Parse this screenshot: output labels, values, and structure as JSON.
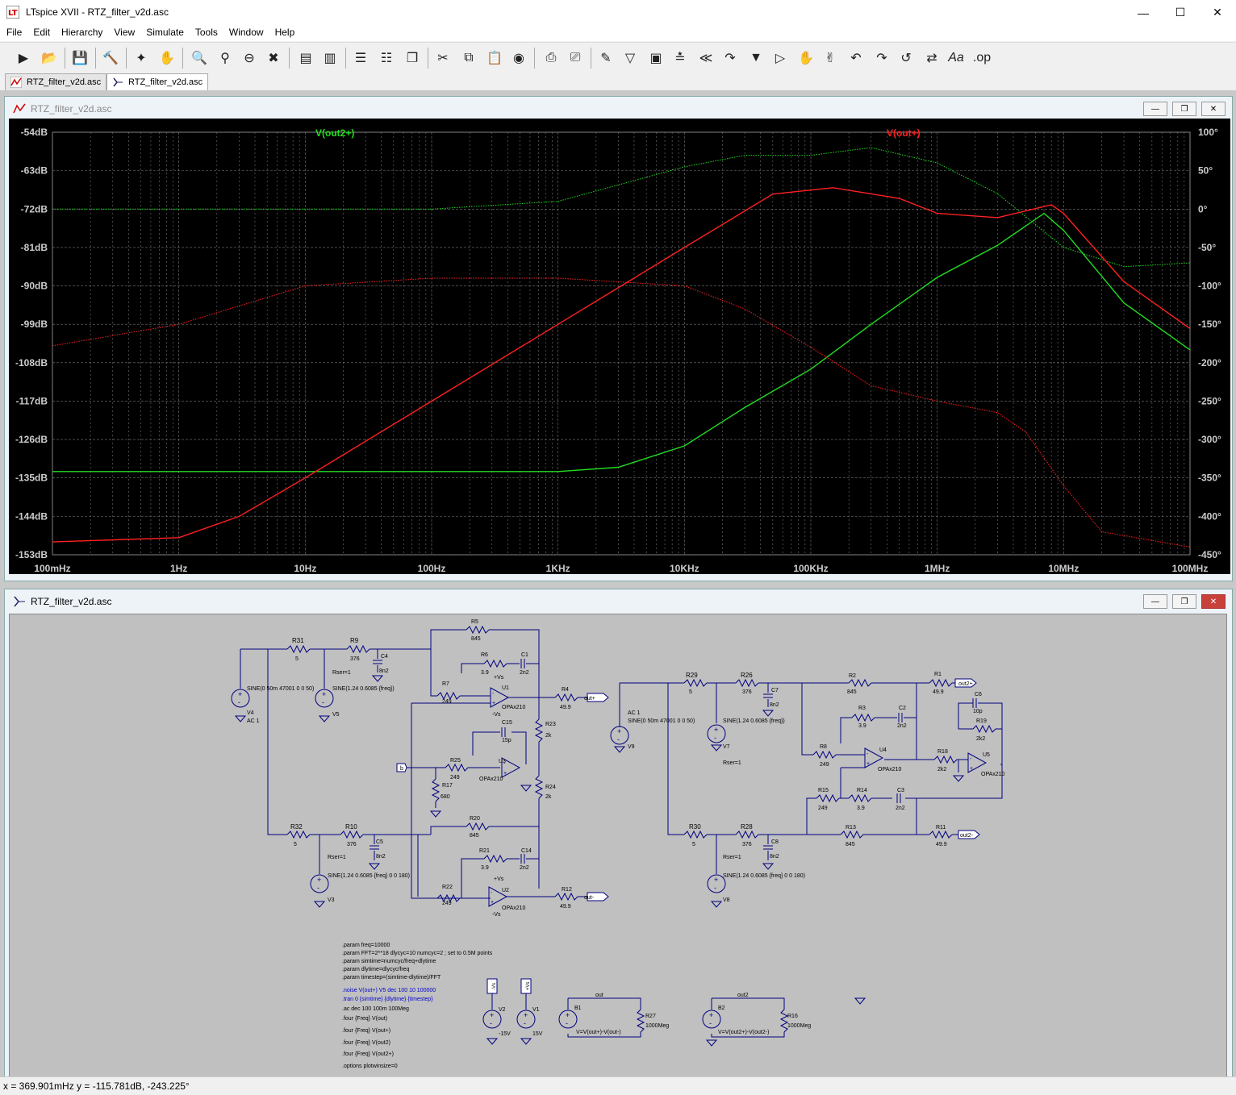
{
  "window": {
    "title": "LTspice XVII - RTZ_filter_v2d.asc"
  },
  "menu": [
    "File",
    "Edit",
    "Hierarchy",
    "View",
    "Simulate",
    "Tools",
    "Window",
    "Help"
  ],
  "tabs": [
    {
      "label": "RTZ_filter_v2d.asc",
      "kind": "waveform"
    },
    {
      "label": "RTZ_filter_v2d.asc",
      "kind": "schematic"
    }
  ],
  "plot_window": {
    "title": "RTZ_filter_v2d.asc"
  },
  "schematic_window": {
    "title": "RTZ_filter_v2d.asc"
  },
  "chart_data": {
    "type": "line",
    "x_scale": "log",
    "x_ticks": [
      "100mHz",
      "1Hz",
      "10Hz",
      "100Hz",
      "1KHz",
      "10KHz",
      "100KHz",
      "1MHz",
      "10MHz",
      "100MHz"
    ],
    "y_left_ticks": [
      "-54dB",
      "-63dB",
      "-72dB",
      "-81dB",
      "-90dB",
      "-99dB",
      "-108dB",
      "-117dB",
      "-126dB",
      "-135dB",
      "-144dB",
      "-153dB"
    ],
    "y_right_ticks": [
      "100°",
      "50°",
      "0°",
      "-50°",
      "-100°",
      "-150°",
      "-200°",
      "-250°",
      "-300°",
      "-350°",
      "-400°",
      "-450°"
    ],
    "ylim_db": [
      -153,
      -54
    ],
    "ylim_deg": [
      -450,
      100
    ],
    "grid": true,
    "series": [
      {
        "name": "V(out2+)",
        "color": "#22dd22",
        "kind": "magnitude",
        "x": [
          0.1,
          1,
          10,
          100,
          1000,
          3000,
          10000,
          30000,
          100000,
          300000,
          1000000,
          3000000,
          7000000,
          10000000,
          30000000,
          100000000
        ],
        "y": [
          -133.5,
          -133.5,
          -133.5,
          -133.5,
          -133.5,
          -132.5,
          -127.5,
          -118.5,
          -109.5,
          -99,
          -88,
          -80.5,
          -73,
          -77,
          -94,
          -105
        ]
      },
      {
        "name": "V(out2+)",
        "color": "#22dd22",
        "kind": "phase",
        "x": [
          0.1,
          1,
          10,
          100,
          1000,
          10000,
          30000,
          100000,
          300000,
          1000000,
          3000000,
          10000000,
          30000000,
          100000000
        ],
        "y": [
          0,
          0,
          0,
          0,
          10,
          55,
          70,
          70,
          80,
          60,
          20,
          -50,
          -75,
          -70
        ]
      },
      {
        "name": "V(out+)",
        "color": "#ff2020",
        "kind": "magnitude",
        "x": [
          0.1,
          1,
          3,
          10,
          100,
          1000,
          10000,
          50000,
          150000,
          500000,
          1000000,
          3000000,
          8000000,
          10000000,
          30000000,
          100000000
        ],
        "y": [
          -150,
          -149,
          -144,
          -135,
          -117,
          -99,
          -81,
          -68.5,
          -67,
          -69.5,
          -73,
          -74,
          -71,
          -73,
          -89,
          -100
        ]
      },
      {
        "name": "V(out+)",
        "color": "#ff2020",
        "kind": "phase",
        "x": [
          0.1,
          1,
          10,
          100,
          1000,
          10000,
          30000,
          100000,
          300000,
          1000000,
          3000000,
          5000000,
          10000000,
          20000000,
          100000000
        ],
        "y": [
          -178,
          -150,
          -100,
          -90,
          -90,
          -100,
          -130,
          -180,
          -230,
          -250,
          -265,
          -290,
          -360,
          -420,
          -440
        ]
      }
    ]
  },
  "schematic": {
    "directives": [
      ".param freq=10000",
      ".param FFT=2**18 dlycyc=10 numcyc=2 ; set to 0.5M points",
      ".param simtime=numcyc/freq+dlytime",
      ".param dlytime=dlycyc/freq",
      ".param timestep=(simtime-dlytime)/FFT"
    ],
    "active_commands": [
      ".noise V(out+) V5 dec 100 10 100000",
      ".tran 0 {simtime} {dlytime} {timestep}"
    ],
    "commands": [
      ".ac dec 100 100m 100Meg",
      ".four {Freq} V(out)",
      ".four {Freq} V(out+)",
      ".four {Freq} V(out2)",
      ".four {Freq} V(out2+)",
      ".options plotwinsize=0"
    ],
    "labels": {
      "R31": "R31",
      "R31v": "5",
      "R9": "R9",
      "R9v": "376",
      "C4": "C4",
      "C4v": "8n2",
      "R5": "R5",
      "R5v": "845",
      "R6": "R6",
      "R6v": "3.9",
      "C1": "C1",
      "C1v": "2n2",
      "R7": "R7",
      "R7v": "249",
      "U1": "U1",
      "opamp": "OPAx210",
      "R4": "R4",
      "R4v": "49.9",
      "outp": "out+",
      "R23": "R23",
      "R23v": "2k",
      "C15": "C15",
      "C15v": "15p",
      "R25": "R25",
      "R25v": "249",
      "U3": "U3",
      "R17": "R17",
      "R17v": "680",
      "R24": "R24",
      "R24v": "2k",
      "R32": "R32",
      "R32v": "5",
      "R10": "R10",
      "R10v": "376",
      "C5": "C5",
      "C5v": "8n2",
      "R20": "R20",
      "R20v": "845",
      "R21": "R21",
      "R21v": "3.9",
      "C14": "C14",
      "C14v": "2n2",
      "R22": "R22",
      "R22v": "249",
      "U2": "U2",
      "R12": "R12",
      "R12v": "49.9",
      "outm": "out-",
      "V4": "V4",
      "V4ac": "AC 1",
      "V4sine": "SINE(0 50m 47001 0 0 50)",
      "V5": "V5",
      "V5sine": "SINE(1.24 0.6085 {freq})",
      "rser": "Rser=1",
      "V3": "V3",
      "V3sine": "SINE(1.24 0.6085 {freq} 0 0 180)",
      "b": "b",
      "R29": "R29",
      "R29v": "5",
      "R26": "R26",
      "R26v": "376",
      "C7": "C7",
      "C7v": "8n2",
      "R2": "R2",
      "R2v": "845",
      "R1": "R1",
      "R1v": "49.9",
      "out2p": "out2+",
      "C6": "C6",
      "C6v": "10p",
      "R19": "R19",
      "R19v": "2k2",
      "R3": "R3",
      "R3v": "3.9",
      "C2": "C2",
      "C2v": "2n2",
      "R8": "R8",
      "R8v": "249",
      "U4": "U4",
      "R18": "R18",
      "R18v": "2k2",
      "U5": "U5",
      "V9": "V9",
      "V9ac": "AC 1",
      "V9sine": "SINE(0 50m 47001 0 0 50)",
      "V7": "V7",
      "V7sine": "SINE(1.24 0.6085 {freq})",
      "R15": "R15",
      "R15v": "249",
      "R14": "R14",
      "R14v": "3.9",
      "C3": "C3",
      "C3v": "2n2",
      "R30": "R30",
      "R30v": "5",
      "R28": "R28",
      "R28v": "376",
      "C8": "C8",
      "C8v": "8n2",
      "R13": "R13",
      "R13v": "845",
      "R11": "R11",
      "R11v": "49.9",
      "out2m": "out2-",
      "V8": "V8",
      "V8sine": "SINE(1.24 0.6085 {freq} 0 0 180)",
      "V2": "V2",
      "V2v": "-15V",
      "V1": "V1",
      "V1v": "15V",
      "vsm": "-Vs",
      "vsp": "+Vs",
      "B1": "B1",
      "B1expr": "V=V(out+)-V(out-)",
      "R27": "R27",
      "R27v": "1000Meg",
      "outlbl": "out",
      "B2": "B2",
      "B2expr": "V=V(out2+)-V(out2-)",
      "R16": "R16",
      "R16v": "1000Meg",
      "out2lbl": "out2"
    }
  },
  "status": {
    "text": "x = 369.901mHz    y = -115.781dB, -243.225°"
  }
}
